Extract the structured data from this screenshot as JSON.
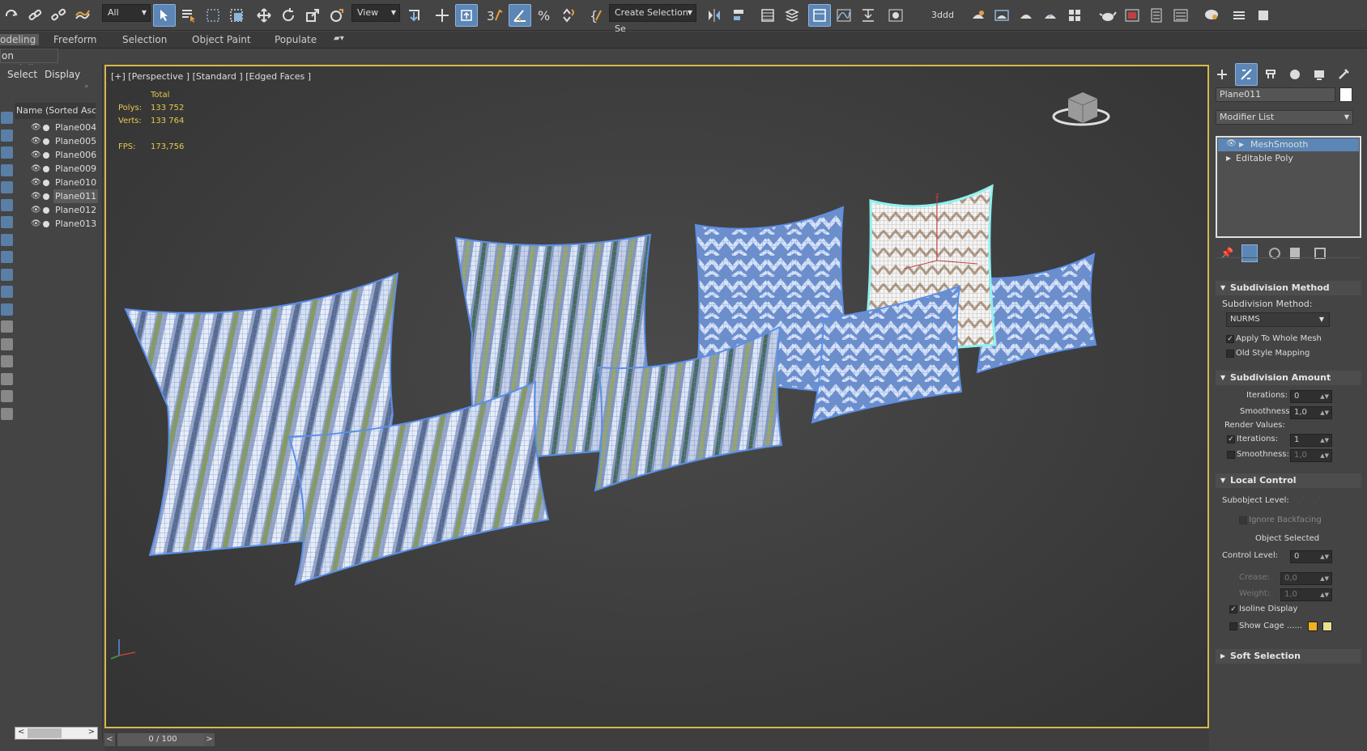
{
  "toolbar": {
    "selection_filter": "All",
    "ref_coord": "View",
    "named_selection": "Create Selection Se",
    "workspace_label": "3ddd"
  },
  "ribbon": {
    "tabs": [
      "odeling",
      "Freeform",
      "Selection",
      "Object Paint",
      "Populate"
    ]
  },
  "polymodeling_label": "on Modeling",
  "scene_explorer": {
    "menu": [
      "Select",
      "Display"
    ],
    "column_header": "Name (Sorted Ascen",
    "items": [
      {
        "name": "Plane004",
        "selected": false
      },
      {
        "name": "Plane005",
        "selected": false
      },
      {
        "name": "Plane006",
        "selected": false
      },
      {
        "name": "Plane009",
        "selected": false
      },
      {
        "name": "Plane010",
        "selected": false
      },
      {
        "name": "Plane011",
        "selected": true
      },
      {
        "name": "Plane012",
        "selected": false
      },
      {
        "name": "Plane013",
        "selected": false
      }
    ]
  },
  "viewport": {
    "label": "[+] [Perspective ] [Standard ] [Edged Faces ]",
    "stats": {
      "total_label": "Total",
      "polys_label": "Polys:",
      "polys_value": "133 752",
      "verts_label": "Verts:",
      "verts_value": "133 764",
      "fps_label": "FPS:",
      "fps_value": "173,756"
    },
    "gizmo_axis_label": "z"
  },
  "modify_panel": {
    "object_name": "Plane011",
    "modifier_list": "Modifier List",
    "stack": [
      {
        "name": "MeshSmooth",
        "selected": true
      },
      {
        "name": "Editable Poly",
        "selected": false
      }
    ],
    "subdivision_method": {
      "title": "Subdivision Method",
      "method_label": "Subdivision Method:",
      "method_value": "NURMS",
      "apply_whole_mesh": "Apply To Whole Mesh",
      "old_style": "Old Style Mapping"
    },
    "subdivision_amount": {
      "title": "Subdivision Amount",
      "iterations_label": "Iterations:",
      "iterations_value": "0",
      "smoothness_label": "Smoothness:",
      "smoothness_value": "1,0",
      "render_values": "Render Values:",
      "render_iterations_label": "Iterations:",
      "render_iterations_value": "1",
      "render_smoothness_label": "Smoothness:",
      "render_smoothness_value": "1,0"
    },
    "local_control": {
      "title": "Local Control",
      "subobject_level": "Subobject Level:",
      "ignore_backfacing": "Ignore Backfacing",
      "object_selected": "Object Selected",
      "control_level_label": "Control Level:",
      "control_level_value": "0",
      "crease_label": "Crease:",
      "crease_value": "0,0",
      "weight_label": "Weight:",
      "weight_value": "1,0",
      "isoline_display": "Isoline Display",
      "show_cage": "Show Cage ......"
    },
    "soft_selection": {
      "title": "Soft Selection"
    }
  },
  "timeline": {
    "frame": "0 / 100",
    "prev": "<",
    "next": ">"
  },
  "colors": {
    "accent_blue": "#5b86b5",
    "viewport_border": "#d8b94a",
    "wire_blue": "#5b8fe8",
    "stats_yellow": "#e6c84a",
    "cage_color_1": "#f0b020",
    "cage_color_2": "#e8e090"
  }
}
